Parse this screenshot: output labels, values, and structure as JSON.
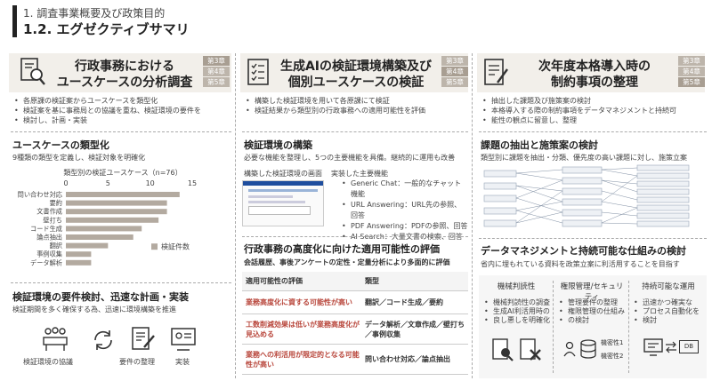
{
  "header": {
    "line1": "1. 調査事業概要及び政策目的",
    "line2": "1.2. エグゼクティブサマリ"
  },
  "chips": [
    "第3章",
    "第4章",
    "第5章"
  ],
  "col1": {
    "title_l1": "行政事務における",
    "title_l2": "ユースケースの分析調査",
    "bullets": [
      "各原課の検証案からユースケースを類型化",
      "検証案を基に事務局との協議を重ね、検証環境の要件を",
      "検討し、計画・実装"
    ],
    "sec1_title": "ユースケースの類型化",
    "sec1_sub": "9種類の類型を定義し、検証対象を明確化",
    "sec2_title": "検証環境の要件検討、迅速な計画・実装",
    "sec2_sub": "検証期間を多く確保する為、迅速に環境構築を推進",
    "icons": [
      "検証環境の協議",
      "要件の整理",
      "実装"
    ]
  },
  "chart_data": {
    "type": "bar",
    "orientation": "horizontal",
    "title": "類型別の検証ユースケース（n=76）",
    "categories": [
      "問い合わせ対応",
      "要約",
      "文書作成",
      "壁打ち",
      "コード生成",
      "論点抽出",
      "翻訳",
      "事例収集",
      "データ解析"
    ],
    "values": [
      13.5,
      12,
      12,
      11,
      9,
      8,
      5,
      3,
      3
    ],
    "xlim": [
      0,
      15
    ],
    "xticks": [
      0,
      5,
      10,
      15
    ],
    "legend": "検証件数",
    "color": "#b3aaa0"
  },
  "col2": {
    "title_l1": "生成AIの検証環境構築及び",
    "title_l2": "個別ユースケースの検証",
    "bullets": [
      "構築した検証環境を用いて各原課にて検証",
      "検証結果から類型別の行政事務への適用可能性を評価"
    ],
    "sec1_title": "検証環境の構築",
    "sec1_sub": "必要な機能を整理し、5つの主要機能を具備。継続的に運用も改善",
    "screen_label": "構築した検証環境の画面",
    "features_label": "実装した主要機能",
    "features": [
      "Generic Chat：一般的なチャット機能",
      "URL Answering：URL先の参照、回答",
      "PDF Answering：PDFの参照、回答",
      "AI Search：大量文書の検索、回答"
    ],
    "sec2_title": "行政事務の高度化に向けた適用可能性の評価",
    "sec2_sub": "会話履歴、事後アンケートの定性・定量分析により多面的に評価",
    "table_head": [
      "適用可能性の評価",
      "類型"
    ],
    "table_rows": [
      [
        "業務高度化に資する可能性が高い",
        "翻訳／コード生成／要約"
      ],
      [
        "工数削減効果は低いが業務高度化が見込める",
        "データ解析／文章作成／壁打ち／事例収集"
      ],
      [
        "業務への利活用が限定的となる可能性が高い",
        "問い合わせ対応／論点抽出"
      ]
    ]
  },
  "col3": {
    "title_l1": "次年度本格導入時の",
    "title_l2": "制約事項の整理",
    "bullets": [
      "抽出した課題及び施策案の検討",
      "本格導入する際の制約事項をデータマネジメントと持続可",
      "能性の観点に留意し、整理"
    ],
    "sec1_title": "課題の抽出と施策案の検討",
    "sec1_sub": "類型別に課題を抽出・分類、優先度の高い課題に対し、施策立案",
    "sec2_title": "データマネジメントと持続可能な仕組みの検討",
    "sec2_sub": "省内に埋もれている資料を政策立案に利活用することを目指す",
    "boxes": [
      {
        "title": "機械判読性",
        "items": [
          "機械判読性の調査",
          "生成AI利活用時の",
          "良し悪しを明確化"
        ]
      },
      {
        "title": "権限管理/セキュリティ",
        "items": [
          "管理要件の整理",
          "権限管理の仕組み",
          "の検討"
        ]
      },
      {
        "title": "持続可能な運用",
        "items": [
          "迅速かつ確実な",
          "プロセス自動化を",
          "検討"
        ]
      }
    ],
    "icon_labels": [
      "機密性1",
      "機密性2",
      "DB"
    ]
  }
}
